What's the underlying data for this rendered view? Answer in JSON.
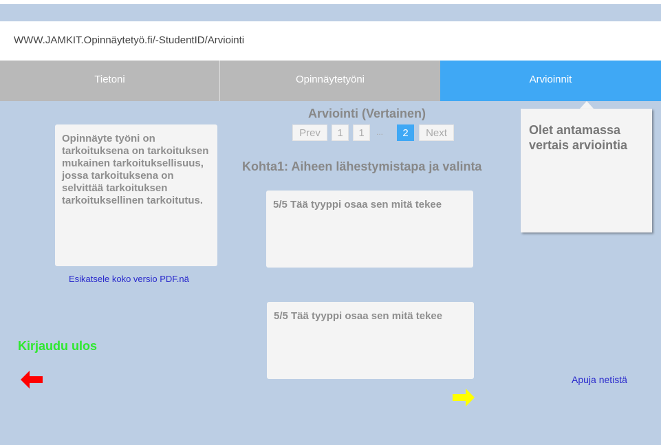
{
  "url": {
    "text": "WWW.JAMKIT.Opinnäytetyö.fi/-StudentID/Arviointi"
  },
  "tabs": [
    {
      "label": "Tietoni"
    },
    {
      "label": "Opinnäytetyöni"
    },
    {
      "label": "Arvioinnit",
      "active": true
    }
  ],
  "notice": {
    "text": "Olet antamassa vertais arviointia"
  },
  "evaluation": {
    "title": "Arviointi (Vertainen)",
    "pager": {
      "prev": "Prev",
      "pages": [
        "1",
        "1",
        "2"
      ],
      "ellipsis": "...",
      "active_page": "2",
      "next": "Next"
    },
    "criterion": "Kohta1: Aiheen lähestymistapa ja valinta",
    "reviews": [
      {
        "text": "5/5 Tää tyyppi osaa sen mitä tekee"
      },
      {
        "text": "5/5 Tää tyyppi osaa sen mitä tekee"
      }
    ]
  },
  "thesis": {
    "summary": "Opinnäyte työni on tarkoituksena on tarkoituksen mukainen tarkoituksellisuus, jossa tarkoituksena on selvittää tarkoituksen tarkoituksellinen tarkoitutus.",
    "pdf_link": "Esikatsele koko versio PDF.nä"
  },
  "footer": {
    "logout": "Kirjaudu ulos",
    "help": "Apuja netistä"
  },
  "colors": {
    "background": "#bccee4",
    "tab_inactive": "#b9b9b9",
    "tab_active": "#3fa8f5",
    "logout": "#2ee82e",
    "link": "#2a2acc",
    "back_arrow": "#ff0000",
    "next_arrow": "#ffff00"
  },
  "icons": {
    "back": "arrow-left-icon",
    "next": "arrow-right-icon"
  }
}
